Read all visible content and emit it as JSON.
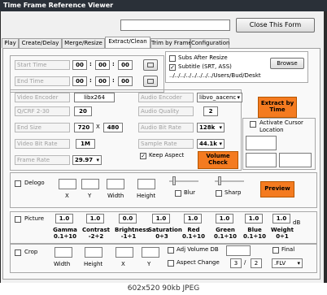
{
  "window": {
    "title": "Time Frame Reference Viewer",
    "close_button": "Close This Form"
  },
  "tabs": [
    "Play",
    "Create/Delay",
    "Merge/Resize",
    "Extract/Clean",
    "Trim by Frame",
    "Configuration"
  ],
  "times": {
    "start_label": "Start Time",
    "end_label": "End Time",
    "start": [
      "00",
      "00",
      "00"
    ],
    "end": [
      "00",
      "00",
      "00"
    ]
  },
  "subs": {
    "after_resize": "Subs After Resize",
    "subtitle": "Subtitle (SRT, ASS)",
    "subtitle_checked": "✓",
    "browse": "Browse",
    "path": "../../../../../../../../Users/Bud/Deskt"
  },
  "video": {
    "encoder_label": "Video Encoder",
    "encoder": "libx264",
    "crf_label": "Q/CRF  2-30",
    "crf": "20",
    "end_size_label": "End Size",
    "width": "720",
    "x": "X",
    "height": "480",
    "bitrate_label": "Video Bit Rate",
    "bitrate": "1M",
    "framerate_label": "Frame Rate",
    "framerate": "29.97"
  },
  "audio": {
    "encoder_label": "Audio Encoder",
    "encoder": "libvo_aacenc",
    "quality_label": "Audio Quality",
    "quality": "2",
    "bitrate_label": "Audio Bit Rate",
    "bitrate": "128k",
    "samplerate_label": "Sample Rate",
    "samplerate": "44.1k",
    "keep_aspect": "Keep Aspect",
    "keep_aspect_checked": "✓",
    "volume_check": "Volume Check"
  },
  "extract": {
    "button": "Extract by Time",
    "activate_cursor": "Activate Cursor Location"
  },
  "delogo": {
    "label": "Delogo",
    "cols": [
      "X",
      "Y",
      "Width",
      "Height"
    ],
    "blur": "Blur",
    "sharp": "Sharp",
    "preview": "Preview"
  },
  "picture": {
    "label": "Picture",
    "db": "dB",
    "values": [
      "1.0",
      "1.0",
      "0.0",
      "1.0",
      "1.0",
      "1.0",
      "1.0",
      "1.0"
    ],
    "names": [
      "Gamma",
      "Contrast",
      "Brightness",
      "Saturation",
      "Red",
      "Green",
      "Blue",
      "Weight"
    ],
    "ranges": [
      "0.1÷10",
      "-2÷2",
      "-1÷1",
      "0÷3",
      "0.1÷10",
      "0.1÷10",
      "0.1÷10",
      "0÷1"
    ]
  },
  "crop": {
    "label": "Crop",
    "cols": [
      "Width",
      "Height",
      "X",
      "Y"
    ],
    "adj_volume": "Adj Volume DB",
    "aspect_change": "Aspect Change",
    "aspect_a": "3",
    "slash": "/",
    "aspect_b": "2",
    "final": "Final",
    "container": ".FLV"
  },
  "footer": "602x520 90kb JPEG"
}
